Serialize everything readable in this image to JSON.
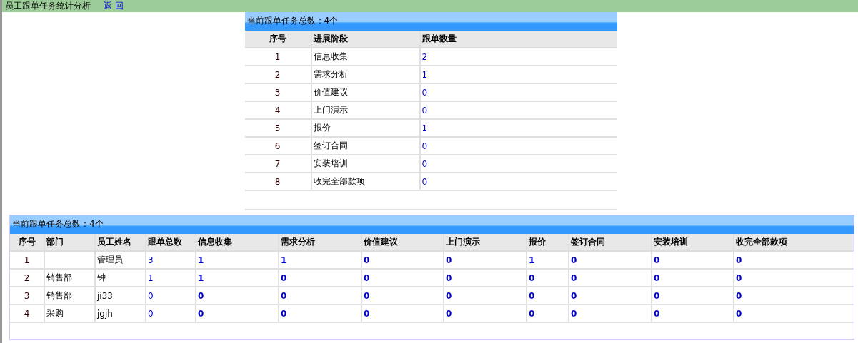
{
  "header": {
    "title": "员工跟单任务统计分析",
    "back_link": "返 回"
  },
  "stage_table": {
    "caption": "当前跟单任务总数：4个",
    "columns": [
      "序号",
      "进展阶段",
      "跟单数量"
    ],
    "rows": [
      {
        "seq": "1",
        "stage": "信息收集",
        "count": "2"
      },
      {
        "seq": "2",
        "stage": "需求分析",
        "count": "1"
      },
      {
        "seq": "3",
        "stage": "价值建议",
        "count": "0"
      },
      {
        "seq": "4",
        "stage": "上门演示",
        "count": "0"
      },
      {
        "seq": "5",
        "stage": "报价",
        "count": "1"
      },
      {
        "seq": "6",
        "stage": "签订合同",
        "count": "0"
      },
      {
        "seq": "7",
        "stage": "安装培训",
        "count": "0"
      },
      {
        "seq": "8",
        "stage": "收完全部款项",
        "count": "0"
      }
    ]
  },
  "employee_table": {
    "caption": "当前跟单任务总数：4个",
    "columns": [
      "序号",
      "部门",
      "员工姓名",
      "跟单总数",
      "信息收集",
      "需求分析",
      "价值建议",
      "上门演示",
      "报价",
      "签订合同",
      "安装培训",
      "收完全部款项"
    ],
    "rows": [
      {
        "seq": "1",
        "employee": "管理员",
        "total": "3",
        "stages": [
          "1",
          "1",
          "0",
          "0",
          "1",
          "0",
          "0",
          "0"
        ]
      },
      {
        "seq": "2",
        "department": "销售部",
        "employee": "钟",
        "total": "1",
        "stages": [
          "1",
          "0",
          "0",
          "0",
          "0",
          "0",
          "0",
          "0"
        ]
      },
      {
        "seq": "3",
        "department": "销售部",
        "employee": "ji33",
        "total": "0",
        "stages": [
          "0",
          "0",
          "0",
          "0",
          "0",
          "0",
          "0",
          "0"
        ]
      },
      {
        "seq": "4",
        "department": "采购",
        "employee": "jgjh",
        "total": "0",
        "stages": [
          "0",
          "0",
          "0",
          "0",
          "0",
          "0",
          "0",
          "0"
        ]
      }
    ]
  }
}
